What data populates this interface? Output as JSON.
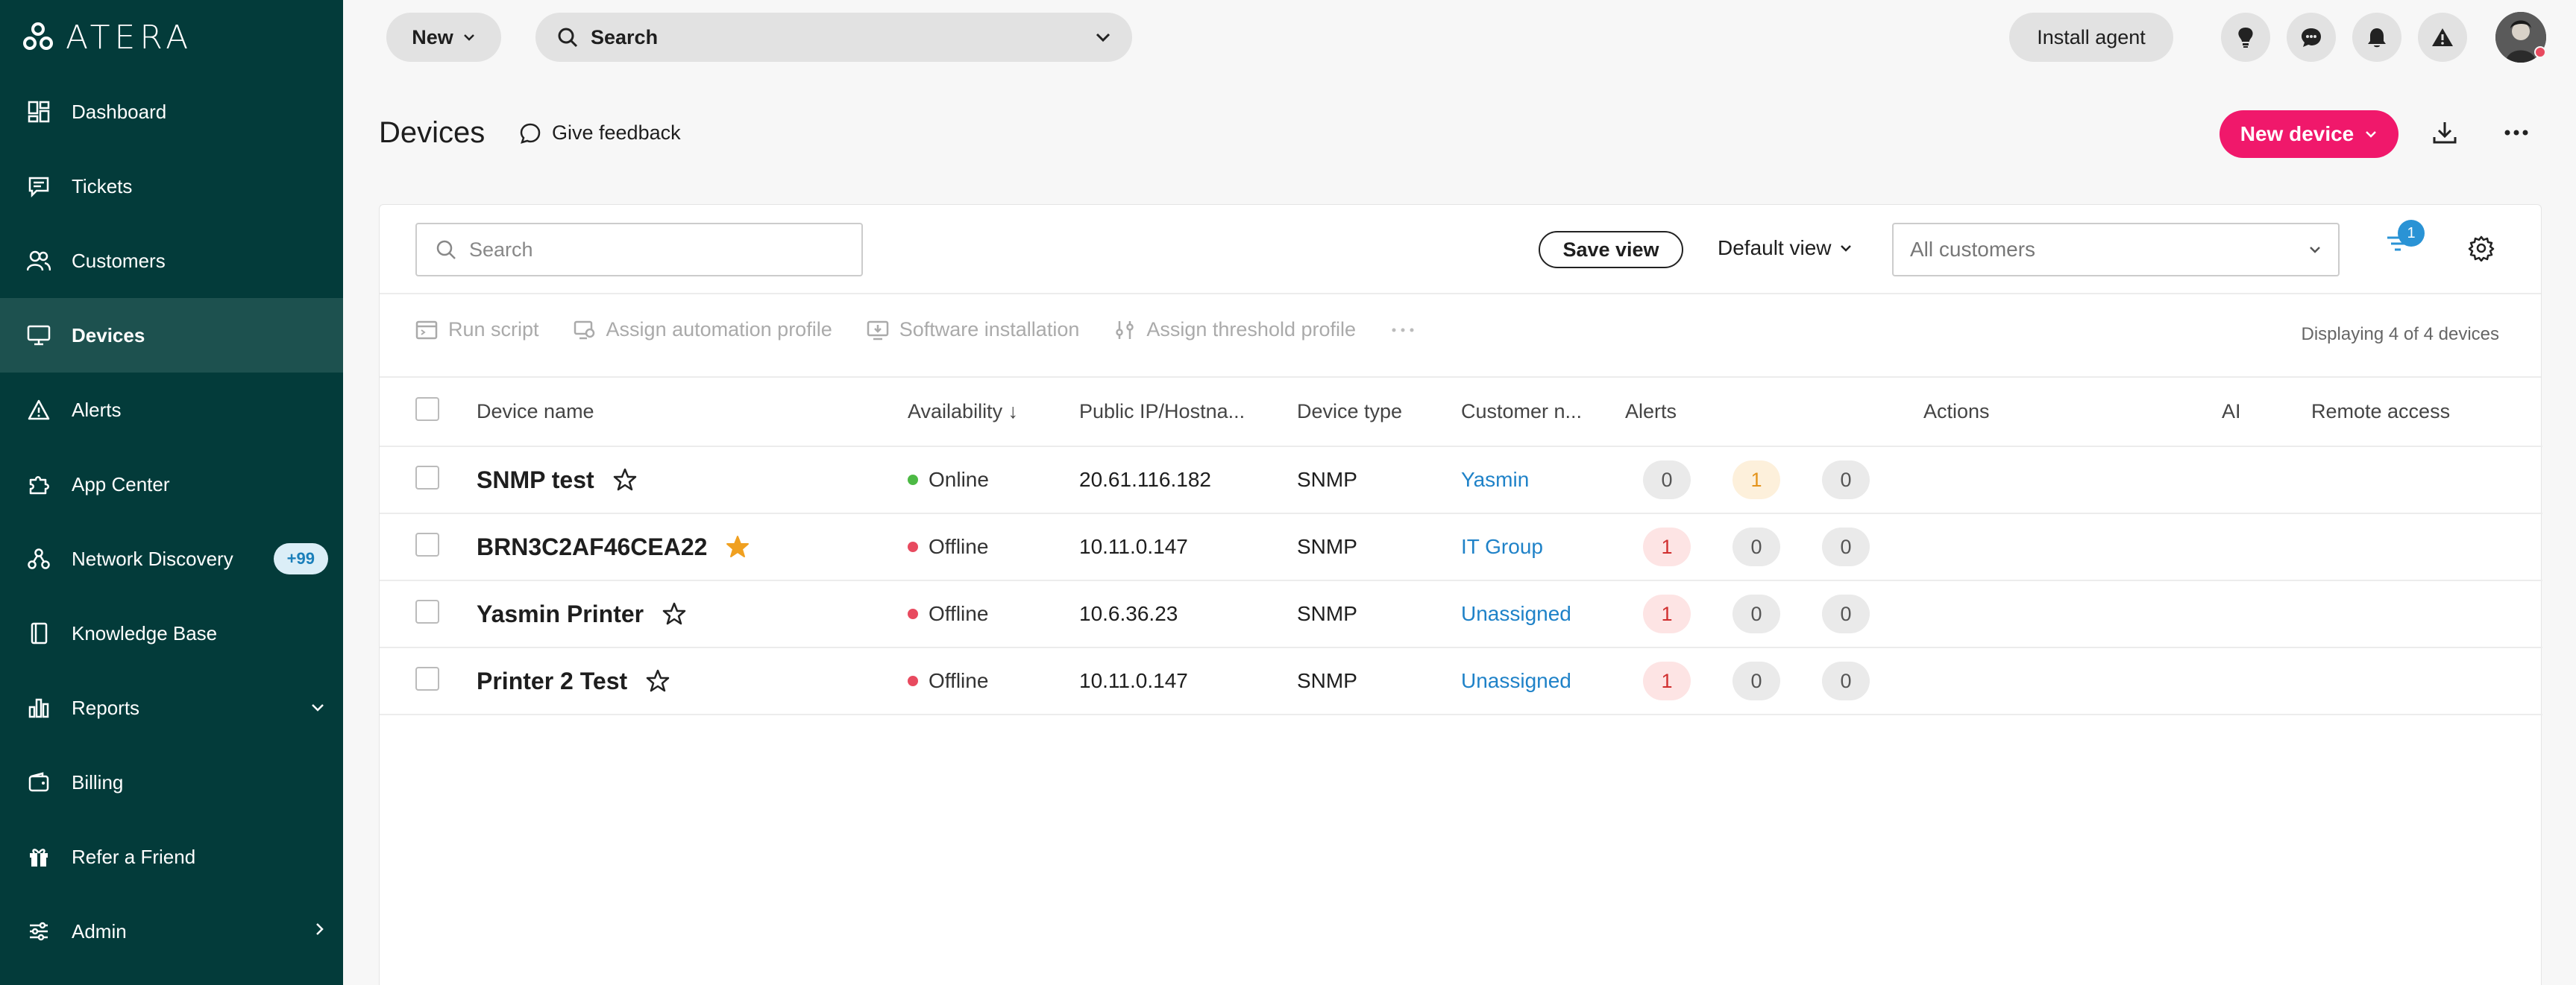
{
  "brand": {
    "name": "ATERA"
  },
  "sidebar": {
    "items": [
      {
        "label": "Dashboard"
      },
      {
        "label": "Tickets"
      },
      {
        "label": "Customers"
      },
      {
        "label": "Devices"
      },
      {
        "label": "Alerts"
      },
      {
        "label": "App Center"
      },
      {
        "label": "Network Discovery",
        "badge": "+99"
      },
      {
        "label": "Knowledge Base"
      },
      {
        "label": "Reports"
      },
      {
        "label": "Billing"
      },
      {
        "label": "Refer a Friend"
      },
      {
        "label": "Admin"
      }
    ]
  },
  "topbar": {
    "new_label": "New",
    "search_label": "Search",
    "install_label": "Install agent"
  },
  "header": {
    "title": "Devices",
    "feedback_label": "Give feedback",
    "new_device_label": "New device"
  },
  "toolbar": {
    "search_placeholder": "Search",
    "save_view_label": "Save view",
    "default_view_label": "Default view",
    "customers_placeholder": "All customers",
    "filter_count": "1"
  },
  "actions": {
    "run_script": "Run script",
    "assign_automation": "Assign automation profile",
    "software_install": "Software installation",
    "assign_threshold": "Assign threshold profile",
    "displaying": "Displaying 4 of 4 devices"
  },
  "table": {
    "columns": [
      "Device name",
      "Availability",
      "Public IP/Hostna...",
      "Device type",
      "Customer n...",
      "Alerts",
      "Actions",
      "AI",
      "Remote access"
    ],
    "rows": [
      {
        "name": "SNMP test",
        "starred": false,
        "availability": "Online",
        "ip": "20.61.116.182",
        "type": "SNMP",
        "customer": "Yasmin",
        "alerts": [
          "0",
          "1",
          "0"
        ]
      },
      {
        "name": "BRN3C2AF46CEA22",
        "starred": true,
        "availability": "Offline",
        "ip": "10.11.0.147",
        "type": "SNMP",
        "customer": "IT Group",
        "alerts": [
          "1",
          "0",
          "0"
        ]
      },
      {
        "name": "Yasmin Printer",
        "starred": false,
        "availability": "Offline",
        "ip": "10.6.36.23",
        "type": "SNMP",
        "customer": "Unassigned",
        "alerts": [
          "1",
          "0",
          "0"
        ]
      },
      {
        "name": "Printer 2 Test",
        "starred": false,
        "availability": "Offline",
        "ip": "10.11.0.147",
        "type": "SNMP",
        "customer": "Unassigned",
        "alerts": [
          "1",
          "0",
          "0"
        ]
      }
    ]
  },
  "colors": {
    "sidebar_bg": "#033b3a",
    "accent": "#f0186b",
    "online": "#4cb944",
    "offline": "#e84a5f",
    "link": "#1f82c8"
  }
}
